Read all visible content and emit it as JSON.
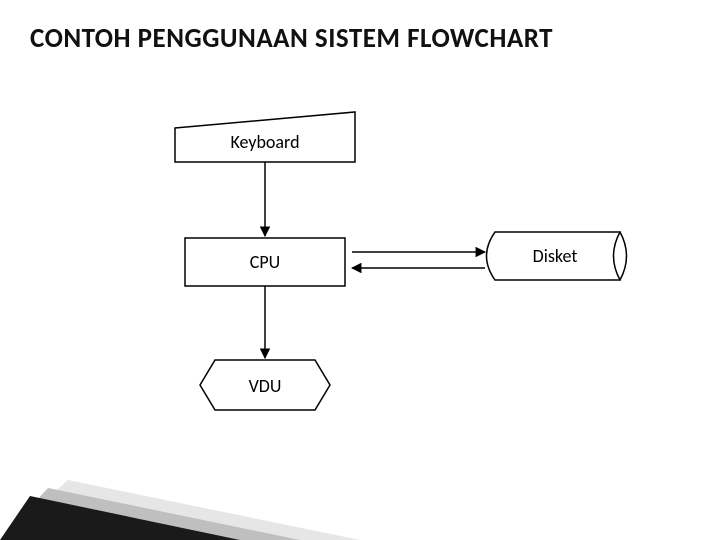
{
  "title": "CONTOH PENGGUNAAN SISTEM FLOWCHART",
  "nodes": {
    "keyboard": "Keyboard",
    "cpu": "CPU",
    "disket": "Disket",
    "vdu": "VDU"
  }
}
